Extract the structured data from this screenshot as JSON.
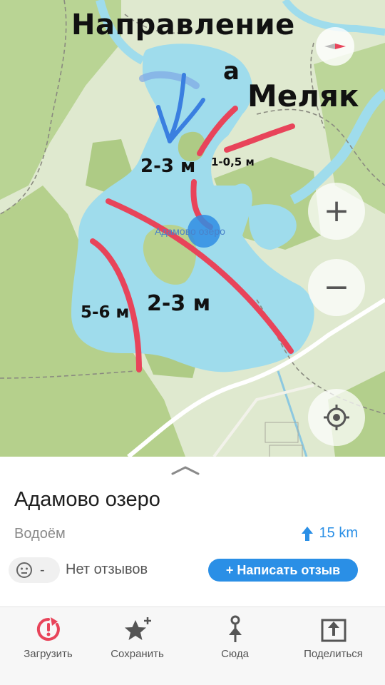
{
  "annotations": {
    "direction_title": "Направление",
    "a_word": "а",
    "melyak": "Меляк",
    "depths": [
      "2-3 м",
      "1-0,5 м",
      "2-3 м",
      "5-6 м"
    ]
  },
  "map": {
    "lake_label": "Адамово озеро",
    "controls": {
      "zoom_in": "+",
      "zoom_out": "−"
    },
    "colors": {
      "water": "#9fdcec",
      "forest": "#b3cf8c",
      "land": "#dfe9cf",
      "marker": "#e8445a",
      "arrow": "#3a7fe0"
    }
  },
  "sheet": {
    "title": "Адамово озеро",
    "type": "Водоём",
    "distance": "15 km",
    "rating": "-",
    "reviews_text": "Нет отзывов",
    "write_review_label": "+ Написать отзыв"
  },
  "tabbar": {
    "items": [
      {
        "label": "Загрузить",
        "icon": "download-clock-icon"
      },
      {
        "label": "Сохранить",
        "icon": "star-plus-icon"
      },
      {
        "label": "Сюда",
        "icon": "route-pin-icon"
      },
      {
        "label": "Поделиться",
        "icon": "share-icon"
      }
    ]
  }
}
